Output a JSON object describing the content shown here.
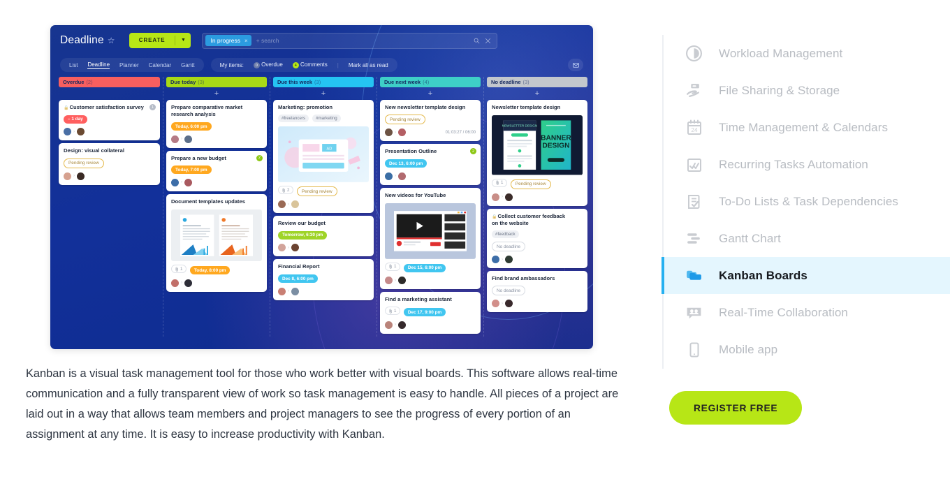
{
  "app": {
    "brand": "Deadline",
    "star_icon": "star-icon",
    "create_label": "CREATE",
    "create_caret": "▼",
    "search": {
      "chip": "In progress",
      "chip_close": "×",
      "placeholder": "+ search",
      "search_icon": "search-icon",
      "clear_icon": "close-icon"
    },
    "nav": {
      "views": [
        {
          "label": "List",
          "active": false
        },
        {
          "label": "Deadline",
          "active": true
        },
        {
          "label": "Planner",
          "active": false
        },
        {
          "label": "Calendar",
          "active": false
        },
        {
          "label": "Gantt",
          "active": false
        }
      ],
      "my_items_label": "My items:",
      "overdue_count": "0",
      "overdue_label": "Overdue",
      "comments_count": "4",
      "comments_label": "Comments",
      "separator": "|",
      "mark_all_label": "Mark all as read",
      "mail_icon": "mail-icon"
    }
  },
  "board": {
    "add_icon": "+",
    "columns": [
      {
        "title": "Overdue",
        "count": "(2)",
        "color": "#f75f5f",
        "cards": [
          {
            "title": "Customer satisfaction survey",
            "lock": true,
            "badge": {
              "text": "1",
              "style": "grey"
            },
            "pill": {
              "text": "– 1 day",
              "style": "pb-red"
            },
            "avatars": [
              "#4a6fa5",
              "#6b4a32"
            ]
          },
          {
            "title": "Design: visual collateral",
            "pill": {
              "text": "Pending review",
              "style": "pb-outline"
            },
            "avatars": [
              "#d6a18f",
              "#3a2a24"
            ]
          }
        ]
      },
      {
        "title": "Due today",
        "count": "(3)",
        "color": "#a8d916",
        "cards": [
          {
            "title": "Prepare comparative market research analysis",
            "pill": {
              "text": "Today, 6:00 pm",
              "style": "pb-orange"
            },
            "avatars": [
              "#b57b86",
              "#5c6f8a"
            ]
          },
          {
            "title": "Prepare a new budget",
            "badge": {
              "text": "2",
              "style": "green"
            },
            "pill": {
              "text": "Today, 7:00 pm",
              "style": "pb-orange"
            },
            "avatars": [
              "#3d6ea8",
              "#a9595f"
            ]
          },
          {
            "title": "Document templates updates",
            "thumb": "documents-thumbnail",
            "attach": "1",
            "pill": {
              "text": "Today, 8:00 pm",
              "style": "pb-orange"
            },
            "avatars": [
              "#c2706a",
              "#2e2e38"
            ]
          }
        ]
      },
      {
        "title": "Due this week",
        "count": "(3)",
        "color": "#25c4f2",
        "cards": [
          {
            "title": "Marketing: promotion",
            "tags": [
              "#freelancers",
              "#marketing"
            ],
            "thumb": "ad-banner-thumbnail",
            "attach": "2",
            "pill": {
              "text": "Pending review",
              "style": "pb-outline"
            },
            "avatars": [
              "#9a6a55",
              "#d9c49a"
            ]
          },
          {
            "title": "Review our budget",
            "pill": {
              "text": "Tomorrow, 6:30 pm",
              "style": "pb-green"
            },
            "avatars": [
              "#d2a49b",
              "#6b4331"
            ]
          },
          {
            "title": "Financial Report",
            "pill": {
              "text": "Dec 8, 6:00 pm",
              "style": "pb-cyan"
            },
            "avatars": [
              "#c97f74",
              "#7b8ea3"
            ]
          }
        ]
      },
      {
        "title": "Due next week",
        "count": "(4)",
        "color": "#3ecfc7",
        "cards": [
          {
            "title": "New newsletter template design",
            "pill": {
              "text": "Pending review",
              "style": "pb-outline"
            },
            "avatars": [
              "#6d5344",
              "#b45f64"
            ],
            "timecode": "01:03:27 / 06:00"
          },
          {
            "title": "Presentation Outline",
            "badge": {
              "text": "2",
              "style": "green"
            },
            "pill": {
              "text": "Dec 13, 6:00 pm",
              "style": "pb-cyan"
            },
            "avatars": [
              "#3b6ea5",
              "#b16a6f"
            ]
          },
          {
            "title": "New videos for YouTube",
            "thumb": "youtube-thumbnail",
            "attach": "1",
            "pill": {
              "text": "Dec 15, 6:00 pm",
              "style": "pb-cyan"
            },
            "avatars": [
              "#c58a8a",
              "#2d2b2a"
            ]
          },
          {
            "title": "Find a marketing assistant",
            "attach": "1",
            "pill": {
              "text": "Dec 17, 9:00 pm",
              "style": "pb-cyan"
            },
            "avatars": [
              "#b9837a",
              "#35292c"
            ]
          }
        ]
      },
      {
        "title": "No deadline",
        "count": "(3)",
        "color": "#c3c7cd",
        "cards": [
          {
            "title": "Newsletter template design",
            "thumb": "newsletter-banner-thumbnail",
            "attach": "1",
            "pill": {
              "text": "Pending review",
              "style": "pb-outline"
            },
            "avatars": [
              "#c98e88",
              "#3b2c2a"
            ]
          },
          {
            "title": "Collect customer feedback on the website",
            "lock": true,
            "tags": [
              "#feedback"
            ],
            "pill": {
              "text": "No deadline",
              "style": "pb-grey"
            },
            "avatars": [
              "#3d6ea8",
              "#2f3b33"
            ]
          },
          {
            "title": "Find brand ambassadors",
            "pill": {
              "text": "No deadline",
              "style": "pb-grey"
            },
            "avatars": [
              "#d28f8a",
              "#39292c"
            ]
          }
        ]
      }
    ]
  },
  "description": "Kanban is a visual task management tool for those who work better with visual boards. This software allows real-time communication and a fully transparent view of work so task management is easy to handle. All pieces of a project are laid out in a way that allows team members and project managers to see the progress of every portion of an assignment at any time. It is easy to increase productivity with Kanban.",
  "sidebar": {
    "items": [
      {
        "label": "Workload Management",
        "icon": "clock-icon",
        "active": false
      },
      {
        "label": "File Sharing & Storage",
        "icon": "file-sharing-icon",
        "active": false
      },
      {
        "label": "Time Management & Calendars",
        "icon": "calendar-24-icon",
        "active": false
      },
      {
        "label": "Recurring Tasks Automation",
        "icon": "recurring-tasks-icon",
        "active": false
      },
      {
        "label": "To-Do Lists & Task Dependencies",
        "icon": "todo-list-icon",
        "active": false
      },
      {
        "label": "Gantt Chart",
        "icon": "gantt-chart-icon",
        "active": false
      },
      {
        "label": "Kanban Boards",
        "icon": "kanban-boards-icon",
        "active": true
      },
      {
        "label": "Real-Time Collaboration",
        "icon": "collaboration-icon",
        "active": false
      },
      {
        "label": "Mobile app",
        "icon": "mobile-phone-icon",
        "active": false
      }
    ],
    "register_label": "REGISTER FREE"
  },
  "colors": {
    "accent_green": "#b7e616",
    "accent_blue": "#25b0f0",
    "board_bg": "#12309a"
  }
}
